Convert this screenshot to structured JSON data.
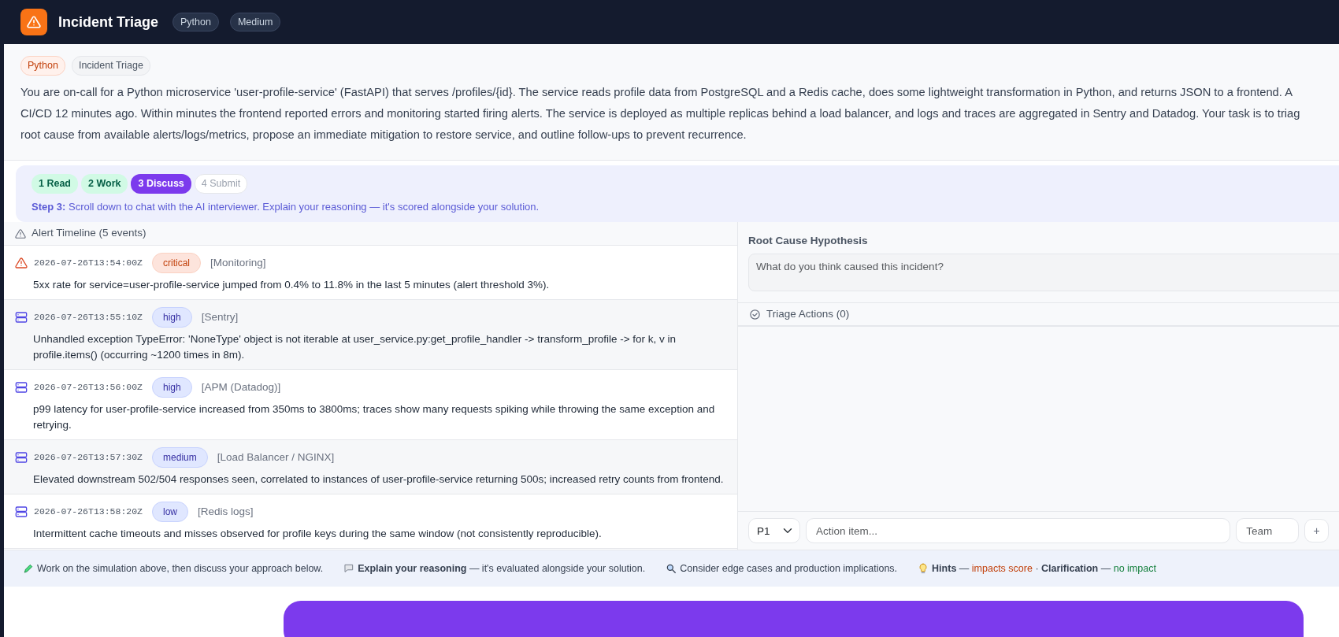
{
  "header": {
    "title": "Incident Triage",
    "tags": [
      "Python",
      "Medium"
    ]
  },
  "task": {
    "tags": [
      {
        "label": "Python",
        "kind": "language"
      },
      {
        "label": "Incident Triage",
        "kind": "topic"
      }
    ],
    "lines": [
      "You are on-call for a Python microservice 'user-profile-service' (FastAPI) that serves /profiles/{id}. The service reads profile data from PostgreSQL and a Redis cache, does some lightweight transformation in Python, and returns JSON to a frontend. A",
      "CI/CD 12 minutes ago. Within minutes the frontend reported errors and monitoring started firing alerts. The service is deployed as multiple replicas behind a load balancer, and logs and traces are aggregated in Sentry and Datadog. Your task is to triag",
      "root cause from available alerts/logs/metrics, propose an immediate mitigation to restore service, and outline follow-ups to prevent recurrence."
    ]
  },
  "steps": [
    {
      "label": "1 Read",
      "done": true,
      "selected": false
    },
    {
      "label": "2 Work",
      "done": true,
      "selected": false
    },
    {
      "label": "3 Discuss",
      "done": false,
      "selected": true
    },
    {
      "label": "4 Submit",
      "done": false,
      "selected": false
    }
  ],
  "step_hint": "**Step 3:** Scroll down to chat with the AI interviewer. Explain your reasoning — it's scored alongside your solution.",
  "timeline": {
    "title": "Alert Timeline (5 events)",
    "alerts": [
      {
        "kind": "warning",
        "time": "2026-07-26T13:54:00Z",
        "severity": "critical",
        "source": "[Monitoring]",
        "message": "5xx rate for service=user-profile-service jumped from 0.4% to 11.8% in the last 5 minutes (alert threshold 3%)."
      },
      {
        "kind": "server",
        "time": "2026-07-26T13:55:10Z",
        "severity": "high",
        "source": "[Sentry]",
        "message": "Unhandled exception TypeError: 'NoneType' object is not iterable at user_service.py:get_profile_handler -> transform_profile -> for k, v in profile.items() (occurring ~1200 times in 8m)."
      },
      {
        "kind": "server",
        "time": "2026-07-26T13:56:00Z",
        "severity": "high",
        "source": "[APM (Datadog)]",
        "message": "p99 latency for user-profile-service increased from 350ms to 3800ms; traces show many requests spiking while throwing the same exception and retrying."
      },
      {
        "kind": "server",
        "time": "2026-07-26T13:57:30Z",
        "severity": "medium",
        "source": "[Load Balancer / NGINX]",
        "message": "Elevated downstream 502/504 responses seen, correlated to instances of user-profile-service returning 500s; increased retry counts from frontend."
      },
      {
        "kind": "server",
        "time": "2026-07-26T13:58:20Z",
        "severity": "low",
        "source": "[Redis logs]",
        "message": "Intermittent cache timeouts and misses observed for profile keys during the same window (not consistently reproducible)."
      }
    ]
  },
  "hypothesis": {
    "label": "Root Cause Hypothesis",
    "placeholder": "What do you think caused this incident?"
  },
  "actions": {
    "title": "Triage Actions (0)",
    "priority": "P1",
    "item_placeholder": "Action item...",
    "team_placeholder": "Team",
    "add": "+"
  },
  "tips": [
    {
      "kind": "pencil",
      "segments": [
        {
          "text": "Work on the simulation above, then discuss your approach below."
        }
      ]
    },
    {
      "kind": "speech",
      "segments": [
        {
          "text": "**Explain your reasoning** — it's evaluated alongside your solution."
        }
      ]
    },
    {
      "kind": "search",
      "segments": [
        {
          "text": "Consider edge cases and production implications."
        }
      ]
    },
    {
      "kind": "bulb",
      "segments": [
        {
          "text": "**Hints** — "
        },
        {
          "text": "impacts score",
          "kind": "cost"
        },
        {
          "text": " · **Clarification** — "
        },
        {
          "text": "no impact",
          "kind": "free"
        }
      ]
    }
  ]
}
